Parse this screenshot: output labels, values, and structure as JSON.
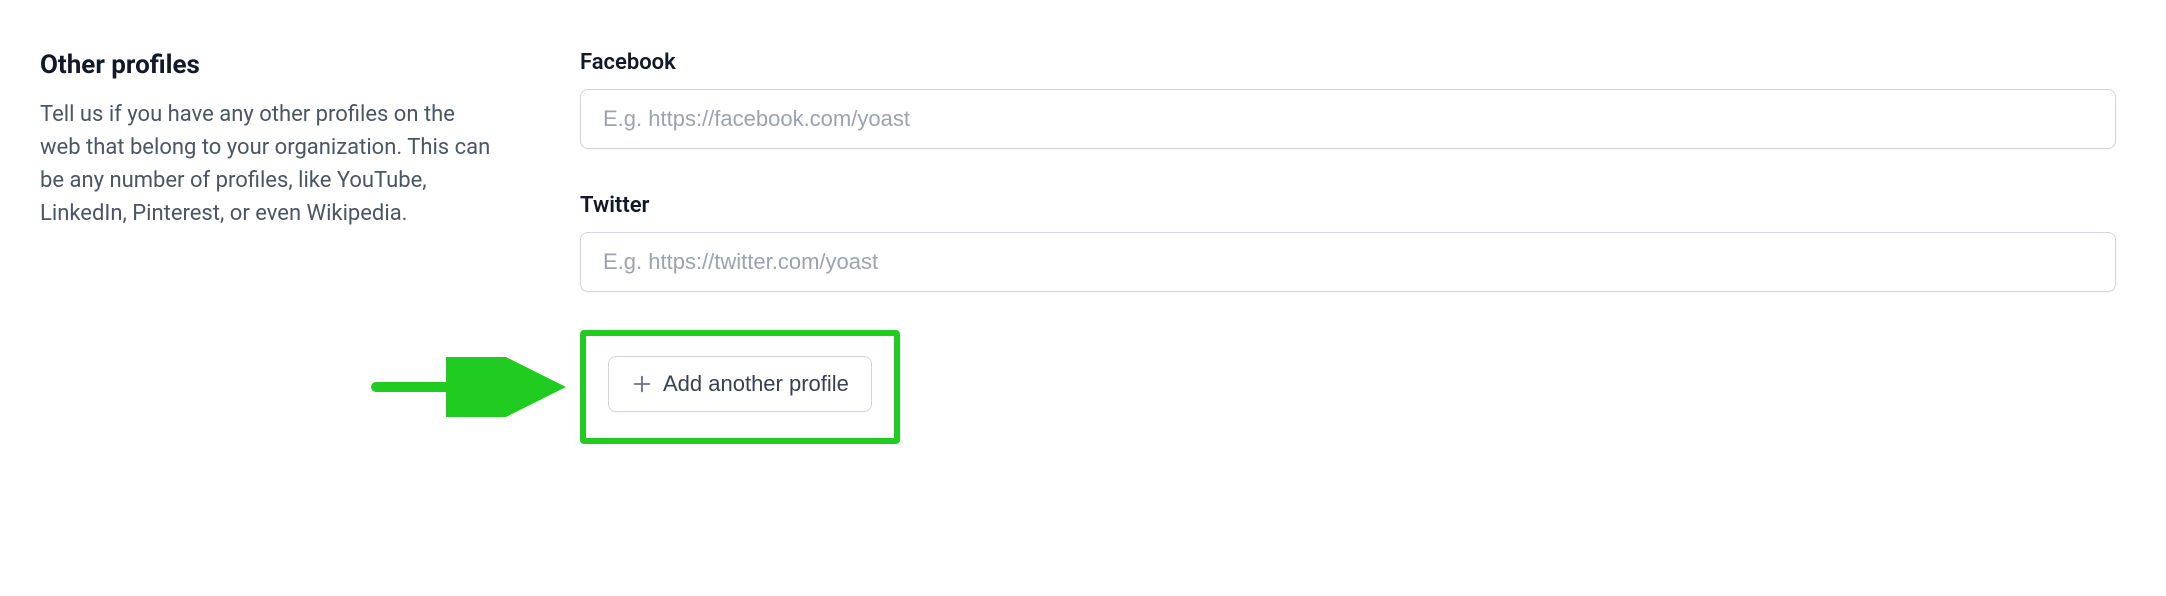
{
  "section": {
    "title": "Other profiles",
    "description": "Tell us if you have any other profiles on the web that belong to your organization. This can be any number of profiles, like YouTube, LinkedIn, Pinterest, or even Wikipedia."
  },
  "fields": {
    "facebook": {
      "label": "Facebook",
      "placeholder": "E.g. https://facebook.com/yoast",
      "value": ""
    },
    "twitter": {
      "label": "Twitter",
      "placeholder": "E.g. https://twitter.com/yoast",
      "value": ""
    }
  },
  "add_button": {
    "label": "Add another profile"
  },
  "annotation": {
    "highlight_color": "#1fcc1f",
    "arrow_color": "#1fcc1f"
  }
}
